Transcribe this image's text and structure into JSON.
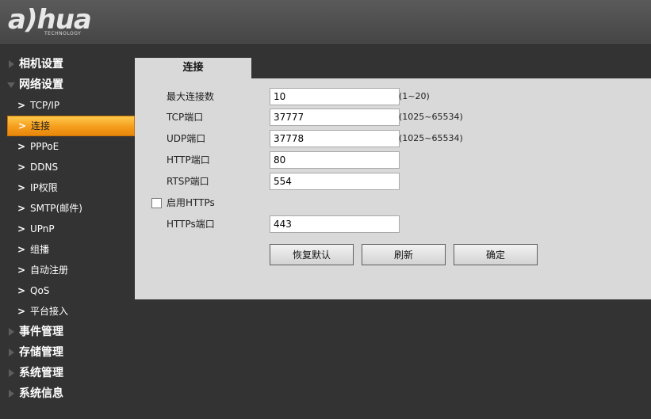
{
  "brand": {
    "logo_text": "a)hua",
    "logo_sub": "TECHNOLOGY"
  },
  "sidebar": {
    "groups_top": [
      {
        "label": "相机设置",
        "expanded": false
      },
      {
        "label": "网络设置",
        "expanded": true
      }
    ],
    "items": [
      {
        "label": "TCP/IP"
      },
      {
        "label": "连接",
        "active": true
      },
      {
        "label": "PPPoE"
      },
      {
        "label": "DDNS"
      },
      {
        "label": "IP权限"
      },
      {
        "label": "SMTP(邮件)"
      },
      {
        "label": "UPnP"
      },
      {
        "label": "组播"
      },
      {
        "label": "自动注册"
      },
      {
        "label": "QoS"
      },
      {
        "label": "平台接入"
      }
    ],
    "groups_bottom": [
      {
        "label": "事件管理"
      },
      {
        "label": "存储管理"
      },
      {
        "label": "系统管理"
      },
      {
        "label": "系统信息"
      }
    ]
  },
  "tab": {
    "label": "连接"
  },
  "form": {
    "max_conn": {
      "label": "最大连接数",
      "value": "10",
      "hint": "(1~20)"
    },
    "tcp_port": {
      "label": "TCP端口",
      "value": "37777",
      "hint": "(1025~65534)"
    },
    "udp_port": {
      "label": "UDP端口",
      "value": "37778",
      "hint": "(1025~65534)"
    },
    "http_port": {
      "label": "HTTP端口",
      "value": "80"
    },
    "rtsp_port": {
      "label": "RTSP端口",
      "value": "554"
    },
    "https_enable": {
      "label": "启用HTTPs",
      "checked": false
    },
    "https_port": {
      "label": "HTTPs端口",
      "value": "443"
    }
  },
  "buttons": {
    "restore": "恢复默认",
    "refresh": "刷新",
    "confirm": "确定"
  }
}
